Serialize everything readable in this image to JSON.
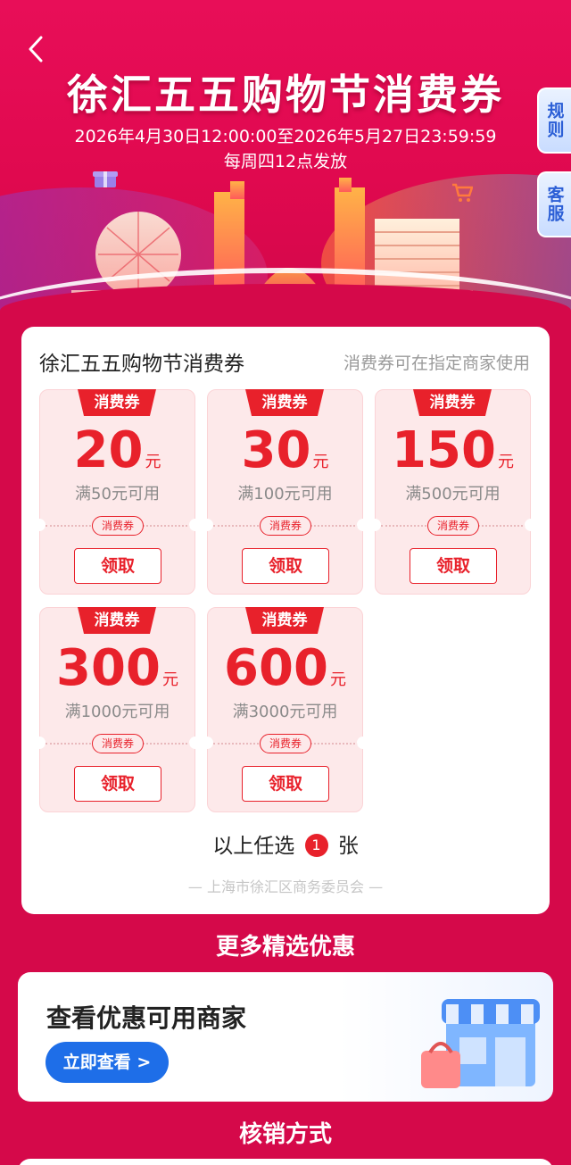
{
  "header": {
    "title": "徐汇五五购物节消费券",
    "date_range": "2026年4月30日12:00:00至2026年5月27日23:59:59",
    "schedule": "每周四12点发放"
  },
  "side_tabs": {
    "rules": "规则",
    "service": "客服"
  },
  "coupon_panel": {
    "title": "徐汇五五购物节消费券",
    "note": "消费券可在指定商家使用",
    "tag_label": "消费券",
    "unit": "元",
    "claim_label": "领取",
    "coupons": [
      {
        "amount": "20",
        "condition": "满50元可用"
      },
      {
        "amount": "30",
        "condition": "满100元可用"
      },
      {
        "amount": "150",
        "condition": "满500元可用"
      },
      {
        "amount": "300",
        "condition": "满1000元可用"
      },
      {
        "amount": "600",
        "condition": "满3000元可用"
      }
    ],
    "pick_prefix": "以上任选",
    "pick_count": "1",
    "pick_suffix": "张",
    "issuer": "— 上海市徐汇区商务委员会 —"
  },
  "more_offers": {
    "section_title": "更多精选优惠",
    "card_title": "查看优惠可用商家",
    "button_label": "立即查看 >"
  },
  "redeem": {
    "section_title": "核销方式"
  },
  "colors": {
    "primary_red": "#e8212b",
    "background": "#d5094a",
    "button_blue": "#1e6ee8"
  }
}
